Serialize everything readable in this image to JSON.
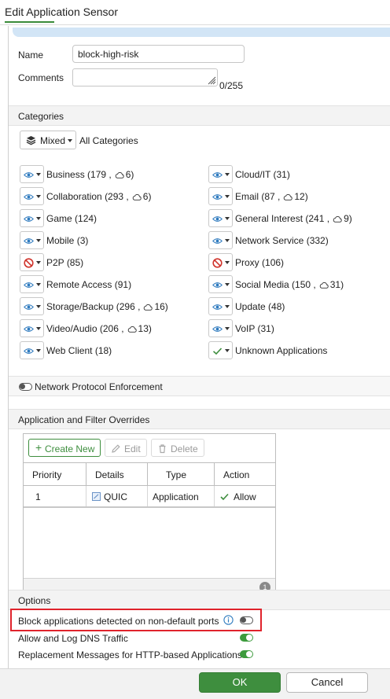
{
  "window": {
    "title": "Edit Application Sensor"
  },
  "form": {
    "name_label": "Name",
    "name_value": "block-high-risk",
    "comments_label": "Comments",
    "comments_value": "",
    "comments_counter": "0/255"
  },
  "categories": {
    "section_title": "Categories",
    "mixed_label": "Mixed",
    "all_categories_label": "All Categories",
    "items": [
      {
        "name": "Business",
        "count": "(179",
        "cloud": "6)",
        "action": "monitor"
      },
      {
        "name": "Cloud/IT",
        "count": "(31)",
        "cloud": "",
        "action": "monitor"
      },
      {
        "name": "Collaboration",
        "count": "(293",
        "cloud": "6)",
        "action": "monitor"
      },
      {
        "name": "Email",
        "count": "(87",
        "cloud": "12)",
        "action": "monitor"
      },
      {
        "name": "Game",
        "count": "(124)",
        "cloud": "",
        "action": "monitor"
      },
      {
        "name": "General Interest",
        "count": "(241",
        "cloud": "9)",
        "action": "monitor"
      },
      {
        "name": "Mobile",
        "count": "(3)",
        "cloud": "",
        "action": "monitor"
      },
      {
        "name": "Network Service",
        "count": "(332)",
        "cloud": "",
        "action": "monitor"
      },
      {
        "name": "P2P",
        "count": "(85)",
        "cloud": "",
        "action": "block"
      },
      {
        "name": "Proxy",
        "count": "(106)",
        "cloud": "",
        "action": "block"
      },
      {
        "name": "Remote Access",
        "count": "(91)",
        "cloud": "",
        "action": "monitor"
      },
      {
        "name": "Social Media",
        "count": "(150",
        "cloud": "31)",
        "action": "monitor"
      },
      {
        "name": "Storage/Backup",
        "count": "(296",
        "cloud": "16)",
        "action": "monitor"
      },
      {
        "name": "Update",
        "count": "(48)",
        "cloud": "",
        "action": "monitor"
      },
      {
        "name": "Video/Audio",
        "count": "(206",
        "cloud": "13)",
        "action": "monitor"
      },
      {
        "name": "VoIP",
        "count": "(31)",
        "cloud": "",
        "action": "monitor"
      },
      {
        "name": "Web Client",
        "count": "(18)",
        "cloud": "",
        "action": "monitor"
      },
      {
        "name": "Unknown Applications",
        "count": "",
        "cloud": "",
        "action": "allow"
      }
    ]
  },
  "network_protocol": {
    "label": "Network Protocol Enforcement",
    "enabled": false
  },
  "overrides": {
    "section_title": "Application and Filter Overrides",
    "create_new": "Create New",
    "edit": "Edit",
    "delete": "Delete",
    "columns": [
      "Priority",
      "Details",
      "Type",
      "Action"
    ],
    "rows": [
      {
        "priority": "1",
        "details": "QUIC",
        "type": "Application",
        "action": "Allow"
      }
    ],
    "count": "1"
  },
  "options": {
    "section_title": "Options",
    "block_non_default_ports": {
      "label": "Block applications detected on non-default ports",
      "enabled": false
    },
    "allow_log_dns": {
      "label": "Allow and Log DNS Traffic",
      "enabled": true
    },
    "replacement_messages": {
      "label": "Replacement Messages for HTTP-based Applications",
      "enabled": true
    }
  },
  "footer": {
    "ok": "OK",
    "cancel": "Cancel"
  },
  "colors": {
    "accent_green": "#3e8e3e",
    "block_red": "#d0342c",
    "monitor_blue": "#2f7bbf",
    "highlight_red": "#e0232c"
  }
}
